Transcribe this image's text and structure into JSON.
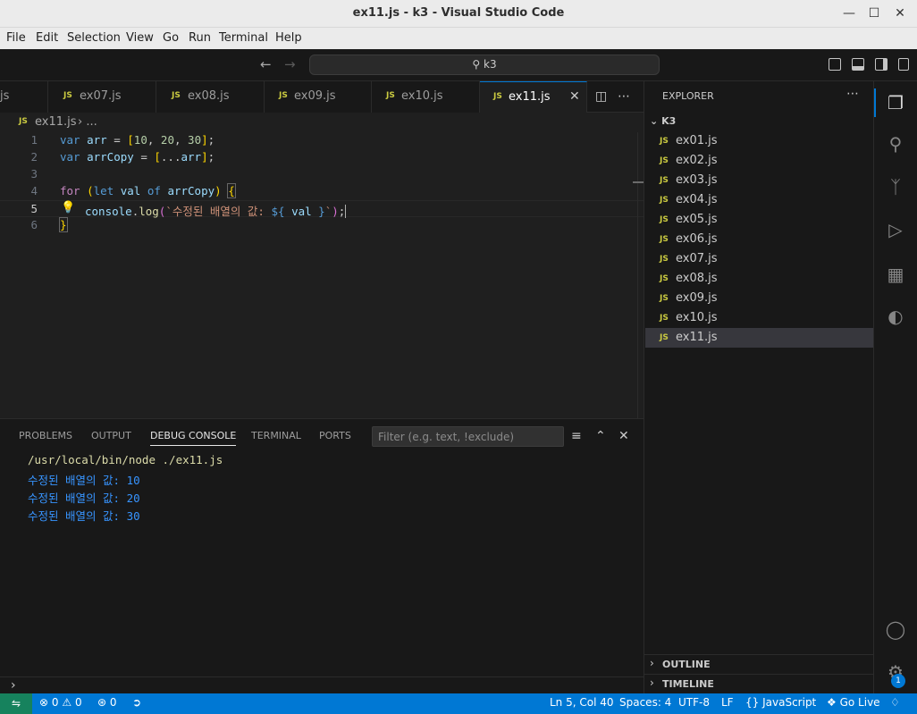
{
  "window": {
    "title": "ex11.js - k3 - Visual Studio Code"
  },
  "menu": [
    "File",
    "Edit",
    "Selection",
    "View",
    "Go",
    "Run",
    "Terminal",
    "Help"
  ],
  "command_center": {
    "query": "k3",
    "search_icon": "search-icon"
  },
  "tabs": [
    {
      "label": "js",
      "partial": true
    },
    {
      "label": "ex07.js"
    },
    {
      "label": "ex08.js"
    },
    {
      "label": "ex09.js"
    },
    {
      "label": "ex10.js"
    },
    {
      "label": "ex11.js",
      "active": true
    }
  ],
  "js_badge": "JS",
  "breadcrumb": {
    "file": "ex11.js",
    "rest": "› ..."
  },
  "editor": {
    "line_numbers": [
      "1",
      "2",
      "3",
      "4",
      "5",
      "6"
    ],
    "current_line": "5"
  },
  "panel": {
    "tabs": [
      "PROBLEMS",
      "OUTPUT",
      "DEBUG CONSOLE",
      "TERMINAL",
      "PORTS"
    ],
    "active_tab": "DEBUG CONSOLE",
    "filter_placeholder": "Filter (e.g. text, !exclude)",
    "output": {
      "path": "/usr/local/bin/node ./ex11.js",
      "lines": [
        "수정된 배열의 값: 10",
        "수정된 배열의 값: 20",
        "수정된 배열의 값: 30"
      ]
    }
  },
  "explorer": {
    "header": "EXPLORER",
    "folder": "K3",
    "files": [
      "ex01.js",
      "ex02.js",
      "ex03.js",
      "ex04.js",
      "ex05.js",
      "ex06.js",
      "ex07.js",
      "ex08.js",
      "ex09.js",
      "ex10.js",
      "ex11.js"
    ],
    "selected": "ex11.js",
    "sections": [
      "OUTLINE",
      "TIMELINE"
    ]
  },
  "activity": {
    "accounts_badge": "1"
  },
  "status": {
    "errors": "0",
    "warnings": "0",
    "ports": "0",
    "position": "Ln 5, Col 40",
    "spaces": "Spaces: 4",
    "encoding": "UTF-8",
    "eol": "LF",
    "language": "JavaScript",
    "golive": "Go Live"
  },
  "colors": {
    "accent": "#0078d4",
    "statusbar": "#0078d4",
    "remote": "#16825d",
    "js_icon": "#cbcb41"
  }
}
